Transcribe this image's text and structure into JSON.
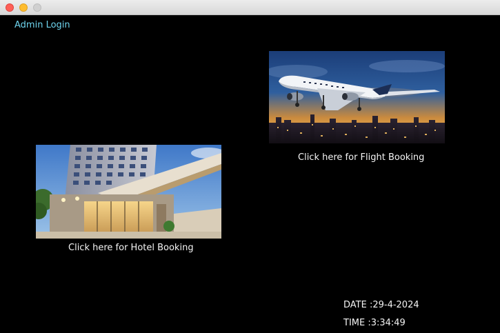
{
  "window": {
    "controls": {
      "close": "close-icon",
      "minimize": "minimize-icon",
      "zoom": "zoom-icon"
    }
  },
  "header": {
    "admin_login_label": "Admin Login"
  },
  "flight": {
    "caption": "Click here for Flight Booking",
    "image_icon": "airplane-over-city-icon"
  },
  "hotel": {
    "caption": "Click here for Hotel Booking",
    "image_icon": "hotel-building-icon"
  },
  "status": {
    "date_text": "DATE :29-4-2024",
    "time_text": "TIME :3:34:49"
  },
  "colors": {
    "background": "#000000",
    "admin_link": "#6fd6f0",
    "caption_text": "#f4f4f4"
  }
}
